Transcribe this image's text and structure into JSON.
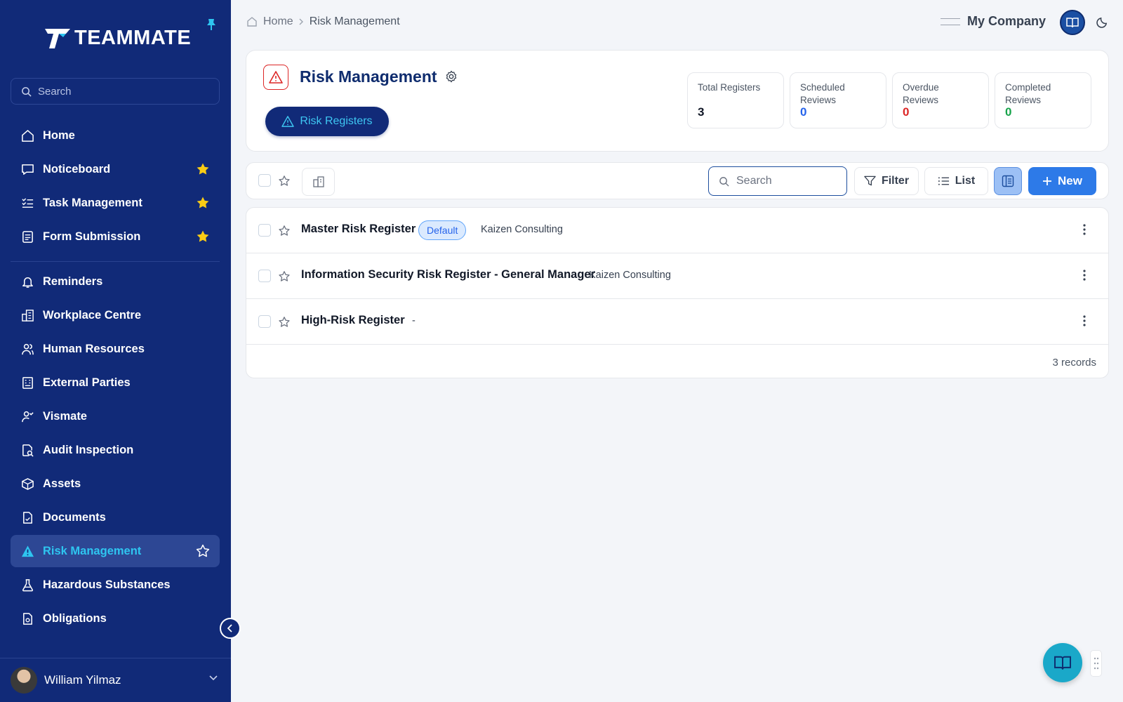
{
  "app": {
    "logo_text": "TEAMMATE"
  },
  "sidebar": {
    "search_placeholder": "Search",
    "items": [
      {
        "label": "Home",
        "icon": "home-icon",
        "starred": false
      },
      {
        "label": "Noticeboard",
        "icon": "message-square-icon",
        "starred": true
      },
      {
        "label": "Task Management",
        "icon": "task-list-icon",
        "starred": true
      },
      {
        "label": "Form Submission",
        "icon": "form-icon",
        "starred": true
      },
      {
        "label": "Reminders",
        "icon": "bell-icon",
        "starred": false
      },
      {
        "label": "Workplace Centre",
        "icon": "building-icon",
        "starred": false
      },
      {
        "label": "Human Resources",
        "icon": "users-icon",
        "starred": false
      },
      {
        "label": "External Parties",
        "icon": "external-parties-icon",
        "starred": false
      },
      {
        "label": "Vismate",
        "icon": "user-check-icon",
        "starred": false
      },
      {
        "label": "Audit Inspection",
        "icon": "audit-search-icon",
        "starred": false
      },
      {
        "label": "Assets",
        "icon": "box-icon",
        "starred": false
      },
      {
        "label": "Documents",
        "icon": "document-icon",
        "starred": false
      },
      {
        "label": "Risk Management",
        "icon": "warning-icon",
        "starred": false,
        "active": true
      },
      {
        "label": "Hazardous Substances",
        "icon": "flask-icon",
        "starred": false
      },
      {
        "label": "Obligations",
        "icon": "obligations-icon",
        "starred": false
      }
    ],
    "user": {
      "name": "William Yilmaz"
    }
  },
  "header": {
    "breadcrumb": {
      "home": "Home",
      "current": "Risk Management"
    },
    "company": "My Company"
  },
  "page": {
    "title": "Risk Management",
    "primary_tab": "Risk Registers",
    "stats": [
      {
        "label_line1": "Total Registers",
        "label_line2": "",
        "value": "3",
        "color": "#111827"
      },
      {
        "label_line1": "Scheduled",
        "label_line2": "Reviews",
        "value": "0",
        "color": "#2563eb"
      },
      {
        "label_line1": "Overdue",
        "label_line2": "Reviews",
        "value": "0",
        "color": "#dc2626"
      },
      {
        "label_line1": "Completed",
        "label_line2": "Reviews",
        "value": "0",
        "color": "#16a34a"
      }
    ]
  },
  "toolbar": {
    "search_placeholder": "Search",
    "filter_label": "Filter",
    "list_label": "List",
    "new_label": "New"
  },
  "registers": [
    {
      "name": "Master Risk Register",
      "badge": "Default",
      "org": "Kaizen Consulting"
    },
    {
      "name": "Information Security Risk Register - General Manager",
      "badge": "",
      "org": "Kaizen Consulting"
    },
    {
      "name": "High-Risk Register",
      "badge": "",
      "org": "-"
    }
  ],
  "footer": {
    "records": "3 records"
  },
  "colors": {
    "sidebar_bg": "#112a78",
    "accent": "#2d7ae8",
    "active_text": "#2ec5f0"
  }
}
